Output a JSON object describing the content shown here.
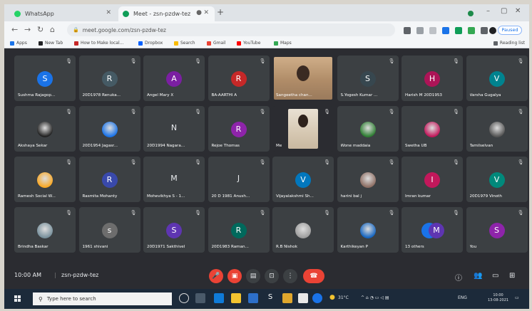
{
  "browser": {
    "tabs": [
      {
        "title": "WhatsApp",
        "favicon_color": "#25d366"
      },
      {
        "title": "Meet - zsn-pzdw-tez",
        "favicon_color": "#0f9d58"
      }
    ],
    "address": "meet.google.com/zsn-pzdw-tez",
    "paused_label": "Paused",
    "bookmarks": [
      "Apps",
      "New Tab",
      "How to Make local...",
      "Dropbox",
      "Search",
      "Gmail",
      "YouTube",
      "Maps"
    ],
    "reading_list": "Reading list"
  },
  "participants": [
    {
      "name": "Sushma Rajagop...",
      "initial": "S",
      "color": "#1a73e8",
      "kind": "avatar"
    },
    {
      "name": "20D1978 Renuka...",
      "initial": "R",
      "color": "#455a64",
      "kind": "avatar"
    },
    {
      "name": "Angel Mary X",
      "initial": "A",
      "color": "#7b1fa2",
      "kind": "avatar"
    },
    {
      "name": "BA-AARTHI A",
      "initial": "R",
      "color": "#c62828",
      "kind": "avatar"
    },
    {
      "name": "Sangeetha chan...",
      "initial": "",
      "color": "#c9a27a",
      "kind": "video"
    },
    {
      "name": "S.Yogesh Kumar ...",
      "initial": "S",
      "color": "#37474f",
      "kind": "avatar"
    },
    {
      "name": "Harish M 20D1953",
      "initial": "H",
      "color": "#ad1457",
      "kind": "avatar"
    },
    {
      "name": "Varsha Gugalya",
      "initial": "V",
      "color": "#00838f",
      "kind": "avatar"
    },
    {
      "name": "Akshaya Sekar",
      "initial": "",
      "color": "#222",
      "kind": "photo"
    },
    {
      "name": "20D1954 Jagasr...",
      "initial": "",
      "color": "#1a73e8",
      "kind": "photo"
    },
    {
      "name": "20D1994 Nagara...",
      "initial": "N",
      "color": "",
      "kind": "letter"
    },
    {
      "name": "Rejoe Thomas",
      "initial": "R",
      "color": "#8e24aa",
      "kind": "avatar"
    },
    {
      "name": "Me",
      "initial": "",
      "color": "#d9cbb5",
      "kind": "video"
    },
    {
      "name": "Wone maddaia",
      "initial": "",
      "color": "#2e7d32",
      "kind": "photo"
    },
    {
      "name": "Swetha UB",
      "initial": "",
      "color": "#c2185b",
      "kind": "photo"
    },
    {
      "name": "Tamilselvan",
      "initial": "",
      "color": "#555",
      "kind": "photo"
    },
    {
      "name": "Ramesh Social W...",
      "initial": "",
      "color": "#f9a825",
      "kind": "photo"
    },
    {
      "name": "Rasmita Mohanty",
      "initial": "R",
      "color": "#3949ab",
      "kind": "avatar"
    },
    {
      "name": "Mohevikhya S - 1...",
      "initial": "M",
      "color": "",
      "kind": "letter"
    },
    {
      "name": "20 D 1981 Anush...",
      "initial": "J",
      "color": "",
      "kind": "letter"
    },
    {
      "name": "Vijayalakshmi Sh...",
      "initial": "V",
      "color": "#0277bd",
      "kind": "avatar"
    },
    {
      "name": "harini bal j",
      "initial": "",
      "color": "#8d6e63",
      "kind": "photo"
    },
    {
      "name": "Imran kumar",
      "initial": "I",
      "color": "#c2185b",
      "kind": "avatar"
    },
    {
      "name": "20D1979 Vinoth",
      "initial": "V",
      "color": "#00897b",
      "kind": "avatar"
    },
    {
      "name": "Brindha Baskar",
      "initial": "",
      "color": "#78909c",
      "kind": "photo"
    },
    {
      "name": "1961 shivani",
      "initial": "s",
      "color": "#6d6d6d",
      "kind": "avatar"
    },
    {
      "name": "20D1971 Sakthivel",
      "initial": "S",
      "color": "#5e35b1",
      "kind": "avatar"
    },
    {
      "name": "20D1983 Raman...",
      "initial": "R",
      "color": "#00695c",
      "kind": "avatar"
    },
    {
      "name": "R.B Nishok",
      "initial": "",
      "color": "#9e9e9e",
      "kind": "photo"
    },
    {
      "name": "Karthikeyan P",
      "initial": "",
      "color": "#1565c0",
      "kind": "photo"
    },
    {
      "name": "13 others",
      "initial": "M",
      "color": "#5e35b1",
      "kind": "others"
    },
    {
      "name": "You",
      "initial": "S",
      "color": "#8e24aa",
      "kind": "avatar"
    }
  ],
  "meetbar": {
    "time": "10:00 AM",
    "code": "zsn-pzdw-tez"
  },
  "taskbar": {
    "search_placeholder": "Type here to search",
    "weather": "31°C",
    "lang": "ENG",
    "time": "10:00",
    "date": "13-08-2021"
  }
}
